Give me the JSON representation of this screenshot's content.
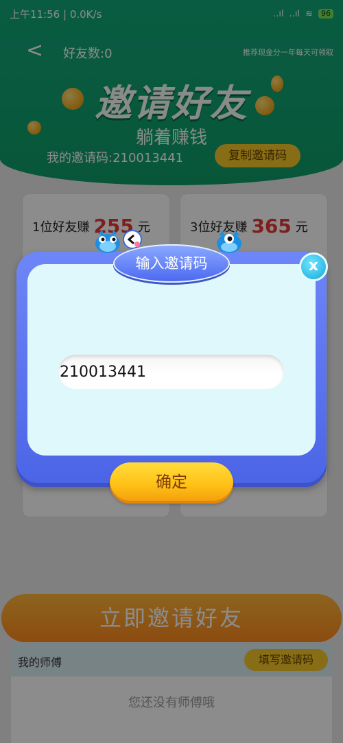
{
  "status_bar": {
    "time_speed": "上午11:56 | 0.0K/s",
    "signal_text": "..ıl",
    "signal2_text": "..ıl",
    "wifi_text": "≋",
    "battery": "96"
  },
  "nav": {
    "back": "<",
    "friends_count": "好友数:0",
    "rules_note": "推荐现金分一年每天可领取"
  },
  "hero": {
    "title": "邀请好友",
    "subtitle": "躺着赚钱",
    "my_invite_code": "我的邀请码:210013441",
    "copy_button": "复制邀请码"
  },
  "reward_cards": [
    {
      "prefix": "1位好友赚",
      "amount": "255",
      "unit": "元"
    },
    {
      "prefix": "3位好友赚",
      "amount": "365",
      "unit": "元"
    }
  ],
  "invite_button": "立即邀请好友",
  "master": {
    "title": "我的师傅",
    "fill_button": "填写邀请码",
    "empty_text": "您还没有师傅哦"
  },
  "dialog": {
    "title": "输入邀请码",
    "close": "x",
    "code_value": "210013441",
    "confirm": "确定"
  },
  "colors": {
    "header_green": "#12a878",
    "dialog_blue": "#5b74ee",
    "dialog_inner": "#dff8fb",
    "confirm_yellow": "#ffc116",
    "accent_red": "#e53a36"
  }
}
